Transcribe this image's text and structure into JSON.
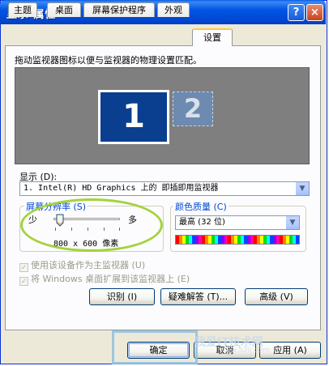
{
  "window": {
    "title": "显示 属性",
    "help_btn": "?",
    "close_btn": "×"
  },
  "tabs": [
    {
      "label": "主题"
    },
    {
      "label": "桌面"
    },
    {
      "label": "屏幕保护程序"
    },
    {
      "label": "外观"
    },
    {
      "label": "设置",
      "active": true
    }
  ],
  "settings": {
    "instruction": "拖动监视器图标以便与监视器的物理设置匹配。",
    "monitors": [
      "1",
      "2"
    ],
    "display_label": "显示 (D):",
    "display_value": "1. Intel(R) HD Graphics 上的 即插即用监视器",
    "resolution": {
      "label": "屏幕分辨率 (S)",
      "less": "少",
      "more": "多",
      "value": "800 x 600 像素",
      "slider_level": 0
    },
    "color_quality": {
      "label": "颜色质量 (C)",
      "value": "最高 (32 位)"
    },
    "checkbox_primary": "使用该设备作为主监视器 (U)",
    "checkbox_extend": "将 Windows 桌面扩展到该监视器上 (E)",
    "identify_btn": "识别 (I)",
    "troubleshoot_btn": "疑难解答 (T)...",
    "advanced_btn": "高级 (V)"
  },
  "footer": {
    "ok_btn": "确定",
    "cancel_btn": "取消",
    "apply_btn": "应用 (A)"
  },
  "watermark": {
    "line1": "我爱IT技术网",
    "line2": "www.52ij.com"
  },
  "colors": {
    "title_blue": "#0054e3",
    "accent_ring": "#a5d23c",
    "selected_monitor": "#0a3f8f"
  }
}
